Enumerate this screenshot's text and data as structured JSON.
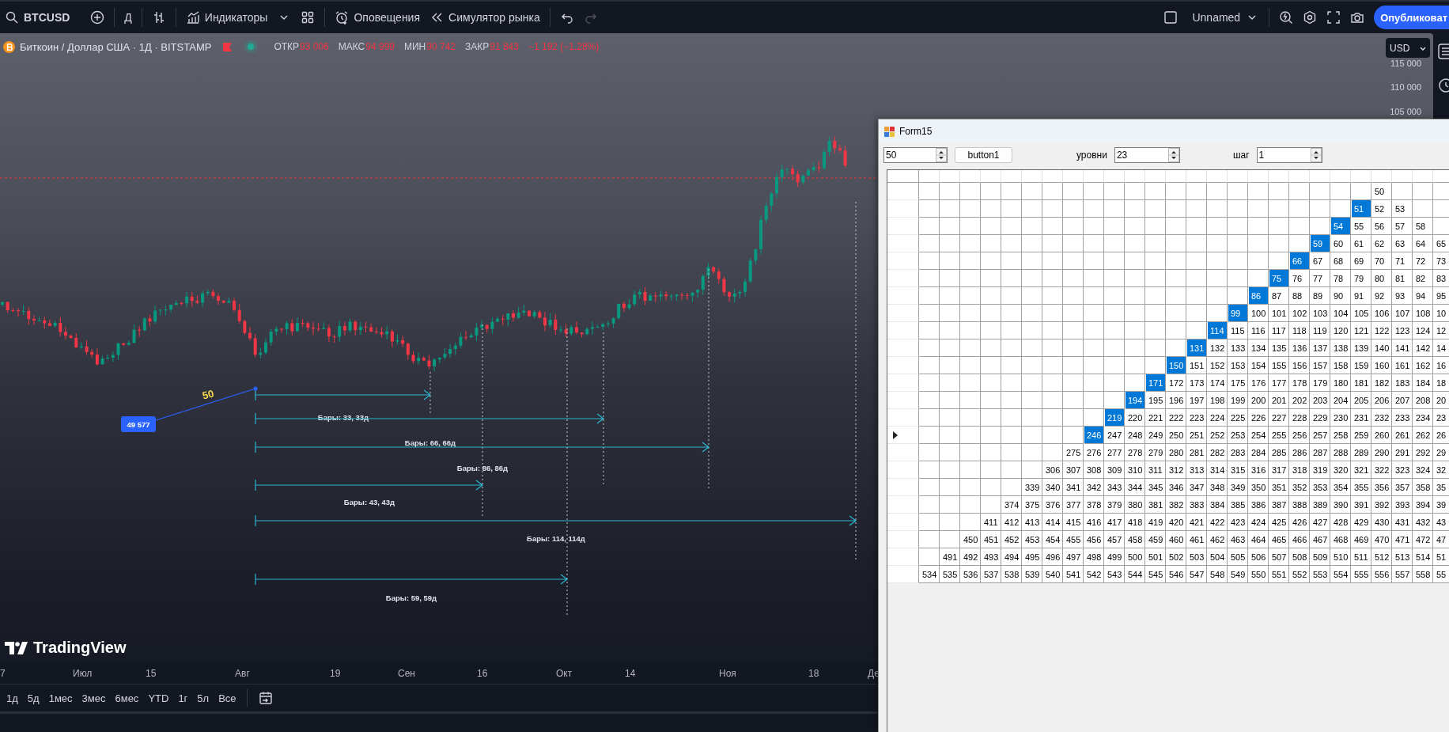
{
  "toolbar": {
    "symbol": "BTCUSD",
    "interval": "Д",
    "indicators": "Индикаторы",
    "alerts": "Оповещения",
    "replay": "Симулятор рынка",
    "undo": {
      "disabled": false
    },
    "redo": {
      "disabled": true
    },
    "layout": "Unnamed",
    "publish": "Опубликоват"
  },
  "legend": {
    "title": "Биткоин / Доллар США · 1Д · BITSTAMP",
    "values": [
      {
        "label": "ОТКР",
        "value": "93 006"
      },
      {
        "label": "МАКС",
        "value": "94 999"
      },
      {
        "label": "МИН",
        "value": "90 742"
      },
      {
        "label": "ЗАКР",
        "value": "91 843"
      }
    ],
    "change": "−1 192 (−1,28%)"
  },
  "currency": "USD",
  "price_scale": [
    "115 000",
    "110 000",
    "105 000"
  ],
  "anchor": {
    "price": "49 577",
    "count": "50"
  },
  "measurements": [
    "Бары: 33, 33д",
    "Бары: 66, 66д",
    "Бары: 86, 86д",
    "Бары: 43, 43д",
    "Бары: 114, 114д",
    "Бары: 59, 59д"
  ],
  "logo": "TradingView",
  "time_axis": [
    "7",
    "Июл",
    "15",
    "Авг",
    "19",
    "Сен",
    "16",
    "Окт",
    "14",
    "Ноя",
    "18",
    "Де"
  ],
  "ranges": [
    "1д",
    "5д",
    "1мес",
    "3мес",
    "6мес",
    "YTD",
    "1г",
    "5л",
    "Все"
  ],
  "form": {
    "title": "Form15",
    "start": "50",
    "button": "button1",
    "levels_label": "уровни",
    "levels": "23",
    "step_label": "шаг",
    "step": "1",
    "rows": [
      {
        "current": false,
        "cells": [
          null,
          null,
          null,
          null,
          null,
          null,
          null,
          null,
          null,
          null,
          null,
          null,
          null,
          null,
          null,
          null,
          null,
          null,
          null,
          null,
          null,
          null,
          {
            "text": "50",
            "selected": false
          },
          null,
          null,
          null
        ]
      },
      {
        "current": false,
        "cells": [
          null,
          null,
          null,
          null,
          null,
          null,
          null,
          null,
          null,
          null,
          null,
          null,
          null,
          null,
          null,
          null,
          null,
          null,
          null,
          null,
          null,
          {
            "text": "51",
            "selected": true
          },
          {
            "text": "52",
            "selected": false
          },
          {
            "text": "53",
            "selected": false
          },
          null,
          null
        ]
      },
      {
        "current": false,
        "cells": [
          null,
          null,
          null,
          null,
          null,
          null,
          null,
          null,
          null,
          null,
          null,
          null,
          null,
          null,
          null,
          null,
          null,
          null,
          null,
          null,
          {
            "text": "54",
            "selected": true
          },
          {
            "text": "55",
            "selected": false
          },
          {
            "text": "56",
            "selected": false
          },
          {
            "text": "57",
            "selected": false
          },
          {
            "text": "58",
            "selected": false
          },
          null
        ]
      },
      {
        "current": false,
        "cells": [
          null,
          null,
          null,
          null,
          null,
          null,
          null,
          null,
          null,
          null,
          null,
          null,
          null,
          null,
          null,
          null,
          null,
          null,
          null,
          {
            "text": "59",
            "selected": true
          },
          {
            "text": "60",
            "selected": false
          },
          {
            "text": "61",
            "selected": false
          },
          {
            "text": "62",
            "selected": false
          },
          {
            "text": "63",
            "selected": false
          },
          {
            "text": "64",
            "selected": false
          },
          {
            "text": "65",
            "selected": false
          }
        ]
      },
      {
        "current": false,
        "cells": [
          null,
          null,
          null,
          null,
          null,
          null,
          null,
          null,
          null,
          null,
          null,
          null,
          null,
          null,
          null,
          null,
          null,
          null,
          {
            "text": "66",
            "selected": true
          },
          {
            "text": "67",
            "selected": false
          },
          {
            "text": "68",
            "selected": false
          },
          {
            "text": "69",
            "selected": false
          },
          {
            "text": "70",
            "selected": false
          },
          {
            "text": "71",
            "selected": false
          },
          {
            "text": "72",
            "selected": false
          },
          {
            "text": "73",
            "selected": false
          }
        ]
      },
      {
        "current": false,
        "cells": [
          null,
          null,
          null,
          null,
          null,
          null,
          null,
          null,
          null,
          null,
          null,
          null,
          null,
          null,
          null,
          null,
          null,
          {
            "text": "75",
            "selected": true
          },
          {
            "text": "76",
            "selected": false
          },
          {
            "text": "77",
            "selected": false
          },
          {
            "text": "78",
            "selected": false
          },
          {
            "text": "79",
            "selected": false
          },
          {
            "text": "80",
            "selected": false
          },
          {
            "text": "81",
            "selected": false
          },
          {
            "text": "82",
            "selected": false
          },
          {
            "text": "83",
            "selected": false
          }
        ]
      },
      {
        "current": false,
        "cells": [
          null,
          null,
          null,
          null,
          null,
          null,
          null,
          null,
          null,
          null,
          null,
          null,
          null,
          null,
          null,
          null,
          {
            "text": "86",
            "selected": true
          },
          {
            "text": "87",
            "selected": false
          },
          {
            "text": "88",
            "selected": false
          },
          {
            "text": "89",
            "selected": false
          },
          {
            "text": "90",
            "selected": false
          },
          {
            "text": "91",
            "selected": false
          },
          {
            "text": "92",
            "selected": false
          },
          {
            "text": "93",
            "selected": false
          },
          {
            "text": "94",
            "selected": false
          },
          {
            "text": "95",
            "selected": false
          }
        ]
      },
      {
        "current": false,
        "cells": [
          null,
          null,
          null,
          null,
          null,
          null,
          null,
          null,
          null,
          null,
          null,
          null,
          null,
          null,
          null,
          {
            "text": "99",
            "selected": true
          },
          {
            "text": "100",
            "selected": false
          },
          {
            "text": "101",
            "selected": false
          },
          {
            "text": "102",
            "selected": false
          },
          {
            "text": "103",
            "selected": false
          },
          {
            "text": "104",
            "selected": false
          },
          {
            "text": "105",
            "selected": false
          },
          {
            "text": "106",
            "selected": false
          },
          {
            "text": "107",
            "selected": false
          },
          {
            "text": "108",
            "selected": false
          },
          {
            "text": "10",
            "selected": false
          }
        ]
      },
      {
        "current": false,
        "cells": [
          null,
          null,
          null,
          null,
          null,
          null,
          null,
          null,
          null,
          null,
          null,
          null,
          null,
          null,
          {
            "text": "114",
            "selected": true
          },
          {
            "text": "115",
            "selected": false
          },
          {
            "text": "116",
            "selected": false
          },
          {
            "text": "117",
            "selected": false
          },
          {
            "text": "118",
            "selected": false
          },
          {
            "text": "119",
            "selected": false
          },
          {
            "text": "120",
            "selected": false
          },
          {
            "text": "121",
            "selected": false
          },
          {
            "text": "122",
            "selected": false
          },
          {
            "text": "123",
            "selected": false
          },
          {
            "text": "124",
            "selected": false
          },
          {
            "text": "12",
            "selected": false
          }
        ]
      },
      {
        "current": false,
        "cells": [
          null,
          null,
          null,
          null,
          null,
          null,
          null,
          null,
          null,
          null,
          null,
          null,
          null,
          {
            "text": "131",
            "selected": true
          },
          {
            "text": "132",
            "selected": false
          },
          {
            "text": "133",
            "selected": false
          },
          {
            "text": "134",
            "selected": false
          },
          {
            "text": "135",
            "selected": false
          },
          {
            "text": "136",
            "selected": false
          },
          {
            "text": "137",
            "selected": false
          },
          {
            "text": "138",
            "selected": false
          },
          {
            "text": "139",
            "selected": false
          },
          {
            "text": "140",
            "selected": false
          },
          {
            "text": "141",
            "selected": false
          },
          {
            "text": "142",
            "selected": false
          },
          {
            "text": "14",
            "selected": false
          }
        ]
      },
      {
        "current": false,
        "cells": [
          null,
          null,
          null,
          null,
          null,
          null,
          null,
          null,
          null,
          null,
          null,
          null,
          {
            "text": "150",
            "selected": true
          },
          {
            "text": "151",
            "selected": false
          },
          {
            "text": "152",
            "selected": false
          },
          {
            "text": "153",
            "selected": false
          },
          {
            "text": "154",
            "selected": false
          },
          {
            "text": "155",
            "selected": false
          },
          {
            "text": "156",
            "selected": false
          },
          {
            "text": "157",
            "selected": false
          },
          {
            "text": "158",
            "selected": false
          },
          {
            "text": "159",
            "selected": false
          },
          {
            "text": "160",
            "selected": false
          },
          {
            "text": "161",
            "selected": false
          },
          {
            "text": "162",
            "selected": false
          },
          {
            "text": "16",
            "selected": false
          }
        ]
      },
      {
        "current": false,
        "cells": [
          null,
          null,
          null,
          null,
          null,
          null,
          null,
          null,
          null,
          null,
          null,
          {
            "text": "171",
            "selected": true
          },
          {
            "text": "172",
            "selected": false
          },
          {
            "text": "173",
            "selected": false
          },
          {
            "text": "174",
            "selected": false
          },
          {
            "text": "175",
            "selected": false
          },
          {
            "text": "176",
            "selected": false
          },
          {
            "text": "177",
            "selected": false
          },
          {
            "text": "178",
            "selected": false
          },
          {
            "text": "179",
            "selected": false
          },
          {
            "text": "180",
            "selected": false
          },
          {
            "text": "181",
            "selected": false
          },
          {
            "text": "182",
            "selected": false
          },
          {
            "text": "183",
            "selected": false
          },
          {
            "text": "184",
            "selected": false
          },
          {
            "text": "18",
            "selected": false
          }
        ]
      },
      {
        "current": false,
        "cells": [
          null,
          null,
          null,
          null,
          null,
          null,
          null,
          null,
          null,
          null,
          {
            "text": "194",
            "selected": true
          },
          {
            "text": "195",
            "selected": false
          },
          {
            "text": "196",
            "selected": false
          },
          {
            "text": "197",
            "selected": false
          },
          {
            "text": "198",
            "selected": false
          },
          {
            "text": "199",
            "selected": false
          },
          {
            "text": "200",
            "selected": false
          },
          {
            "text": "201",
            "selected": false
          },
          {
            "text": "202",
            "selected": false
          },
          {
            "text": "203",
            "selected": false
          },
          {
            "text": "204",
            "selected": false
          },
          {
            "text": "205",
            "selected": false
          },
          {
            "text": "206",
            "selected": false
          },
          {
            "text": "207",
            "selected": false
          },
          {
            "text": "208",
            "selected": false
          },
          {
            "text": "20",
            "selected": false
          }
        ]
      },
      {
        "current": false,
        "cells": [
          null,
          null,
          null,
          null,
          null,
          null,
          null,
          null,
          null,
          {
            "text": "219",
            "selected": true
          },
          {
            "text": "220",
            "selected": false
          },
          {
            "text": "221",
            "selected": false
          },
          {
            "text": "222",
            "selected": false
          },
          {
            "text": "223",
            "selected": false
          },
          {
            "text": "224",
            "selected": false
          },
          {
            "text": "225",
            "selected": false
          },
          {
            "text": "226",
            "selected": false
          },
          {
            "text": "227",
            "selected": false
          },
          {
            "text": "228",
            "selected": false
          },
          {
            "text": "229",
            "selected": false
          },
          {
            "text": "230",
            "selected": false
          },
          {
            "text": "231",
            "selected": false
          },
          {
            "text": "232",
            "selected": false
          },
          {
            "text": "233",
            "selected": false
          },
          {
            "text": "234",
            "selected": false
          },
          {
            "text": "23",
            "selected": false
          }
        ]
      },
      {
        "current": true,
        "cells": [
          null,
          null,
          null,
          null,
          null,
          null,
          null,
          null,
          {
            "text": "246",
            "selected": true
          },
          {
            "text": "247",
            "selected": false
          },
          {
            "text": "248",
            "selected": false
          },
          {
            "text": "249",
            "selected": false
          },
          {
            "text": "250",
            "selected": false
          },
          {
            "text": "251",
            "selected": false
          },
          {
            "text": "252",
            "selected": false
          },
          {
            "text": "253",
            "selected": false
          },
          {
            "text": "254",
            "selected": false
          },
          {
            "text": "255",
            "selected": false
          },
          {
            "text": "256",
            "selected": false
          },
          {
            "text": "257",
            "selected": false
          },
          {
            "text": "258",
            "selected": false
          },
          {
            "text": "259",
            "selected": false
          },
          {
            "text": "260",
            "selected": false
          },
          {
            "text": "261",
            "selected": false
          },
          {
            "text": "262",
            "selected": false
          },
          {
            "text": "26",
            "selected": false
          }
        ]
      },
      {
        "current": false,
        "cells": [
          null,
          null,
          null,
          null,
          null,
          null,
          null,
          {
            "text": "275",
            "selected": false
          },
          {
            "text": "276",
            "selected": false
          },
          {
            "text": "277",
            "selected": false
          },
          {
            "text": "278",
            "selected": false
          },
          {
            "text": "279",
            "selected": false
          },
          {
            "text": "280",
            "selected": false
          },
          {
            "text": "281",
            "selected": false
          },
          {
            "text": "282",
            "selected": false
          },
          {
            "text": "283",
            "selected": false
          },
          {
            "text": "284",
            "selected": false
          },
          {
            "text": "285",
            "selected": false
          },
          {
            "text": "286",
            "selected": false
          },
          {
            "text": "287",
            "selected": false
          },
          {
            "text": "288",
            "selected": false
          },
          {
            "text": "289",
            "selected": false
          },
          {
            "text": "290",
            "selected": false
          },
          {
            "text": "291",
            "selected": false
          },
          {
            "text": "292",
            "selected": false
          },
          {
            "text": "29",
            "selected": false
          }
        ]
      },
      {
        "current": false,
        "cells": [
          null,
          null,
          null,
          null,
          null,
          null,
          {
            "text": "306",
            "selected": false
          },
          {
            "text": "307",
            "selected": false
          },
          {
            "text": "308",
            "selected": false
          },
          {
            "text": "309",
            "selected": false
          },
          {
            "text": "310",
            "selected": false
          },
          {
            "text": "311",
            "selected": false
          },
          {
            "text": "312",
            "selected": false
          },
          {
            "text": "313",
            "selected": false
          },
          {
            "text": "314",
            "selected": false
          },
          {
            "text": "315",
            "selected": false
          },
          {
            "text": "316",
            "selected": false
          },
          {
            "text": "317",
            "selected": false
          },
          {
            "text": "318",
            "selected": false
          },
          {
            "text": "319",
            "selected": false
          },
          {
            "text": "320",
            "selected": false
          },
          {
            "text": "321",
            "selected": false
          },
          {
            "text": "322",
            "selected": false
          },
          {
            "text": "323",
            "selected": false
          },
          {
            "text": "324",
            "selected": false
          },
          {
            "text": "32",
            "selected": false
          }
        ]
      },
      {
        "current": false,
        "cells": [
          null,
          null,
          null,
          null,
          null,
          {
            "text": "339",
            "selected": false
          },
          {
            "text": "340",
            "selected": false
          },
          {
            "text": "341",
            "selected": false
          },
          {
            "text": "342",
            "selected": false
          },
          {
            "text": "343",
            "selected": false
          },
          {
            "text": "344",
            "selected": false
          },
          {
            "text": "345",
            "selected": false
          },
          {
            "text": "346",
            "selected": false
          },
          {
            "text": "347",
            "selected": false
          },
          {
            "text": "348",
            "selected": false
          },
          {
            "text": "349",
            "selected": false
          },
          {
            "text": "350",
            "selected": false
          },
          {
            "text": "351",
            "selected": false
          },
          {
            "text": "352",
            "selected": false
          },
          {
            "text": "353",
            "selected": false
          },
          {
            "text": "354",
            "selected": false
          },
          {
            "text": "355",
            "selected": false
          },
          {
            "text": "356",
            "selected": false
          },
          {
            "text": "357",
            "selected": false
          },
          {
            "text": "358",
            "selected": false
          },
          {
            "text": "35",
            "selected": false
          }
        ]
      },
      {
        "current": false,
        "cells": [
          null,
          null,
          null,
          null,
          {
            "text": "374",
            "selected": false
          },
          {
            "text": "375",
            "selected": false
          },
          {
            "text": "376",
            "selected": false
          },
          {
            "text": "377",
            "selected": false
          },
          {
            "text": "378",
            "selected": false
          },
          {
            "text": "379",
            "selected": false
          },
          {
            "text": "380",
            "selected": false
          },
          {
            "text": "381",
            "selected": false
          },
          {
            "text": "382",
            "selected": false
          },
          {
            "text": "383",
            "selected": false
          },
          {
            "text": "384",
            "selected": false
          },
          {
            "text": "385",
            "selected": false
          },
          {
            "text": "386",
            "selected": false
          },
          {
            "text": "387",
            "selected": false
          },
          {
            "text": "388",
            "selected": false
          },
          {
            "text": "389",
            "selected": false
          },
          {
            "text": "390",
            "selected": false
          },
          {
            "text": "391",
            "selected": false
          },
          {
            "text": "392",
            "selected": false
          },
          {
            "text": "393",
            "selected": false
          },
          {
            "text": "394",
            "selected": false
          },
          {
            "text": "39",
            "selected": false
          }
        ]
      },
      {
        "current": false,
        "cells": [
          null,
          null,
          null,
          {
            "text": "411",
            "selected": false
          },
          {
            "text": "412",
            "selected": false
          },
          {
            "text": "413",
            "selected": false
          },
          {
            "text": "414",
            "selected": false
          },
          {
            "text": "415",
            "selected": false
          },
          {
            "text": "416",
            "selected": false
          },
          {
            "text": "417",
            "selected": false
          },
          {
            "text": "418",
            "selected": false
          },
          {
            "text": "419",
            "selected": false
          },
          {
            "text": "420",
            "selected": false
          },
          {
            "text": "421",
            "selected": false
          },
          {
            "text": "422",
            "selected": false
          },
          {
            "text": "423",
            "selected": false
          },
          {
            "text": "424",
            "selected": false
          },
          {
            "text": "425",
            "selected": false
          },
          {
            "text": "426",
            "selected": false
          },
          {
            "text": "427",
            "selected": false
          },
          {
            "text": "428",
            "selected": false
          },
          {
            "text": "429",
            "selected": false
          },
          {
            "text": "430",
            "selected": false
          },
          {
            "text": "431",
            "selected": false
          },
          {
            "text": "432",
            "selected": false
          },
          {
            "text": "43",
            "selected": false
          }
        ]
      },
      {
        "current": false,
        "cells": [
          null,
          null,
          {
            "text": "450",
            "selected": false
          },
          {
            "text": "451",
            "selected": false
          },
          {
            "text": "452",
            "selected": false
          },
          {
            "text": "453",
            "selected": false
          },
          {
            "text": "454",
            "selected": false
          },
          {
            "text": "455",
            "selected": false
          },
          {
            "text": "456",
            "selected": false
          },
          {
            "text": "457",
            "selected": false
          },
          {
            "text": "458",
            "selected": false
          },
          {
            "text": "459",
            "selected": false
          },
          {
            "text": "460",
            "selected": false
          },
          {
            "text": "461",
            "selected": false
          },
          {
            "text": "462",
            "selected": false
          },
          {
            "text": "463",
            "selected": false
          },
          {
            "text": "464",
            "selected": false
          },
          {
            "text": "465",
            "selected": false
          },
          {
            "text": "466",
            "selected": false
          },
          {
            "text": "467",
            "selected": false
          },
          {
            "text": "468",
            "selected": false
          },
          {
            "text": "469",
            "selected": false
          },
          {
            "text": "470",
            "selected": false
          },
          {
            "text": "471",
            "selected": false
          },
          {
            "text": "472",
            "selected": false
          },
          {
            "text": "47",
            "selected": false
          }
        ]
      },
      {
        "current": false,
        "cells": [
          null,
          {
            "text": "491",
            "selected": false
          },
          {
            "text": "492",
            "selected": false
          },
          {
            "text": "493",
            "selected": false
          },
          {
            "text": "494",
            "selected": false
          },
          {
            "text": "495",
            "selected": false
          },
          {
            "text": "496",
            "selected": false
          },
          {
            "text": "497",
            "selected": false
          },
          {
            "text": "498",
            "selected": false
          },
          {
            "text": "499",
            "selected": false
          },
          {
            "text": "500",
            "selected": false
          },
          {
            "text": "501",
            "selected": false
          },
          {
            "text": "502",
            "selected": false
          },
          {
            "text": "503",
            "selected": false
          },
          {
            "text": "504",
            "selected": false
          },
          {
            "text": "505",
            "selected": false
          },
          {
            "text": "506",
            "selected": false
          },
          {
            "text": "507",
            "selected": false
          },
          {
            "text": "508",
            "selected": false
          },
          {
            "text": "509",
            "selected": false
          },
          {
            "text": "510",
            "selected": false
          },
          {
            "text": "511",
            "selected": false
          },
          {
            "text": "512",
            "selected": false
          },
          {
            "text": "513",
            "selected": false
          },
          {
            "text": "514",
            "selected": false
          },
          {
            "text": "51",
            "selected": false
          }
        ]
      },
      {
        "current": false,
        "cells": [
          {
            "text": "534",
            "selected": false
          },
          {
            "text": "535",
            "selected": false
          },
          {
            "text": "536",
            "selected": false
          },
          {
            "text": "537",
            "selected": false
          },
          {
            "text": "538",
            "selected": false
          },
          {
            "text": "539",
            "selected": false
          },
          {
            "text": "540",
            "selected": false
          },
          {
            "text": "541",
            "selected": false
          },
          {
            "text": "542",
            "selected": false
          },
          {
            "text": "543",
            "selected": false
          },
          {
            "text": "544",
            "selected": false
          },
          {
            "text": "545",
            "selected": false
          },
          {
            "text": "546",
            "selected": false
          },
          {
            "text": "547",
            "selected": false
          },
          {
            "text": "548",
            "selected": false
          },
          {
            "text": "549",
            "selected": false
          },
          {
            "text": "550",
            "selected": false
          },
          {
            "text": "551",
            "selected": false
          },
          {
            "text": "552",
            "selected": false
          },
          {
            "text": "553",
            "selected": false
          },
          {
            "text": "554",
            "selected": false
          },
          {
            "text": "555",
            "selected": false
          },
          {
            "text": "556",
            "selected": false
          },
          {
            "text": "557",
            "selected": false
          },
          {
            "text": "558",
            "selected": false
          },
          {
            "text": "55",
            "selected": false
          }
        ]
      }
    ]
  }
}
